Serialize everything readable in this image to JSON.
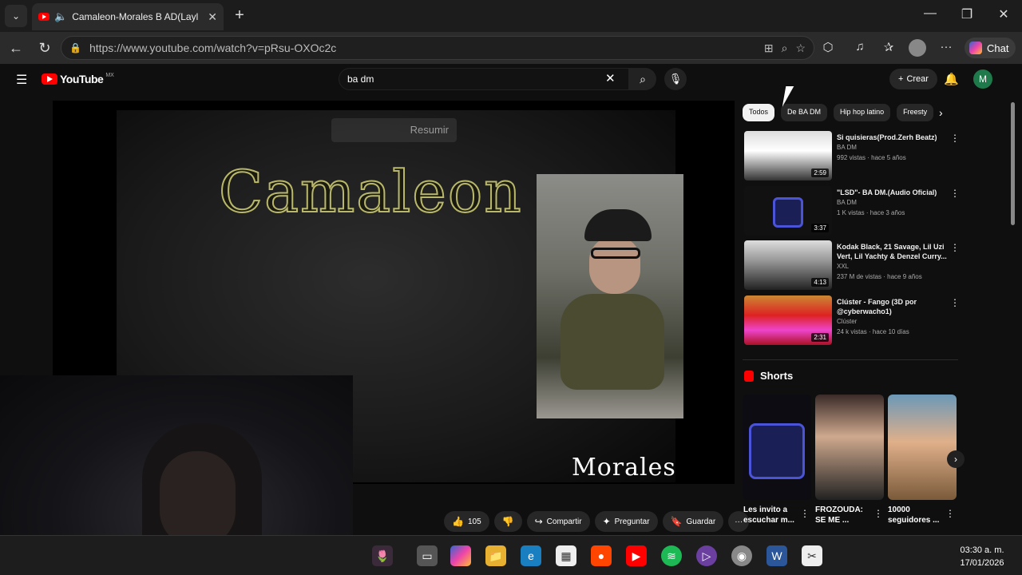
{
  "browser": {
    "tab_title": "Camaleon-Morales B AD(Layl",
    "url_host": "https://www.youtube.com",
    "url_path": "/watch?v=pRsu-OXOc2c",
    "chat_label": "Chat"
  },
  "youtube": {
    "logo_text": "YouTube",
    "region": "MX",
    "search_value": "ba dm",
    "create_label": "Crear",
    "avatar_letter": "M"
  },
  "video": {
    "overlay_title": "Camaleon",
    "overlay_artist": "Morales B AD",
    "summarize_label": "Resumir"
  },
  "actions": {
    "likes": "105",
    "share": "Compartir",
    "ask": "Preguntar",
    "save": "Guardar"
  },
  "chips": [
    "Todos",
    "De BA DM",
    "Hip hop latino",
    "Freesty"
  ],
  "recommendations": [
    {
      "title": "Si quisieras(Prod.Zerh Beatz)",
      "channel": "BA DM",
      "stats": "992 vistas · hace 5 años",
      "duration": "2:59"
    },
    {
      "title": "\"LSD\"- BA DM.(Audio Oficial)",
      "channel": "BA DM",
      "stats": "1 K vistas · hace 3 años",
      "duration": "3:37"
    },
    {
      "title": "Kodak Black, 21 Savage, Lil Uzi Vert, Lil Yachty & Denzel Curry...",
      "channel": "XXL",
      "stats": "237 M de vistas · hace 9 años",
      "duration": "4:13"
    },
    {
      "title": "Clúster - Fango (3D por @cyberwacho1)",
      "channel": "Clúster",
      "stats": "24 k vistas · hace 10 días",
      "duration": "2:31"
    }
  ],
  "shorts": {
    "heading": "Shorts",
    "items": [
      {
        "title": "Les invito a escuchar m..."
      },
      {
        "title": "FROZOUDA: SE ME ..."
      },
      {
        "title": "10000 seguidores ..."
      }
    ]
  },
  "taskbar": {
    "time": "03:30 a. m.",
    "date": "17/01/2026"
  },
  "colors": {
    "youtube_red": "#ff0000",
    "background": "#0f0f0f"
  }
}
